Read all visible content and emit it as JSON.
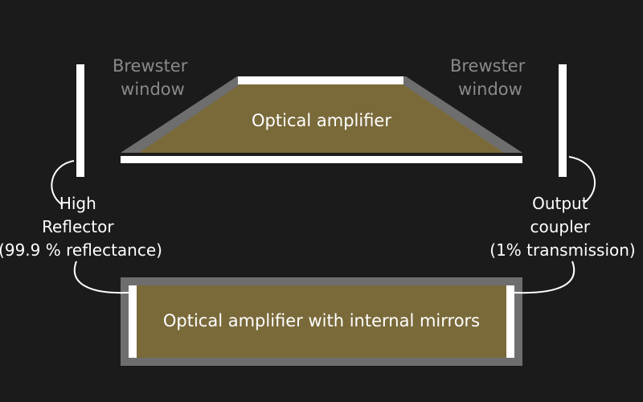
{
  "diagram": {
    "left_window_label": [
      "Brewster",
      "window"
    ],
    "right_window_label": [
      "Brewster",
      "window"
    ],
    "top_amplifier_label": "Optical amplifier",
    "bottom_amplifier_label": "Optical amplifier with internal mirrors",
    "high_reflector_label": [
      "High",
      "Reflector",
      "(99.9 % reflectance)"
    ],
    "output_coupler_label": [
      "Output",
      "coupler",
      "(1% transmission)"
    ]
  },
  "colors": {
    "background": "#1b1b1b",
    "amplifier_fill": "#7a6a3a",
    "housing_gray": "#6e6e6e",
    "mirror_white": "#ffffff",
    "window_label_gray": "#8a8a8a",
    "text_white": "#ffffff"
  }
}
